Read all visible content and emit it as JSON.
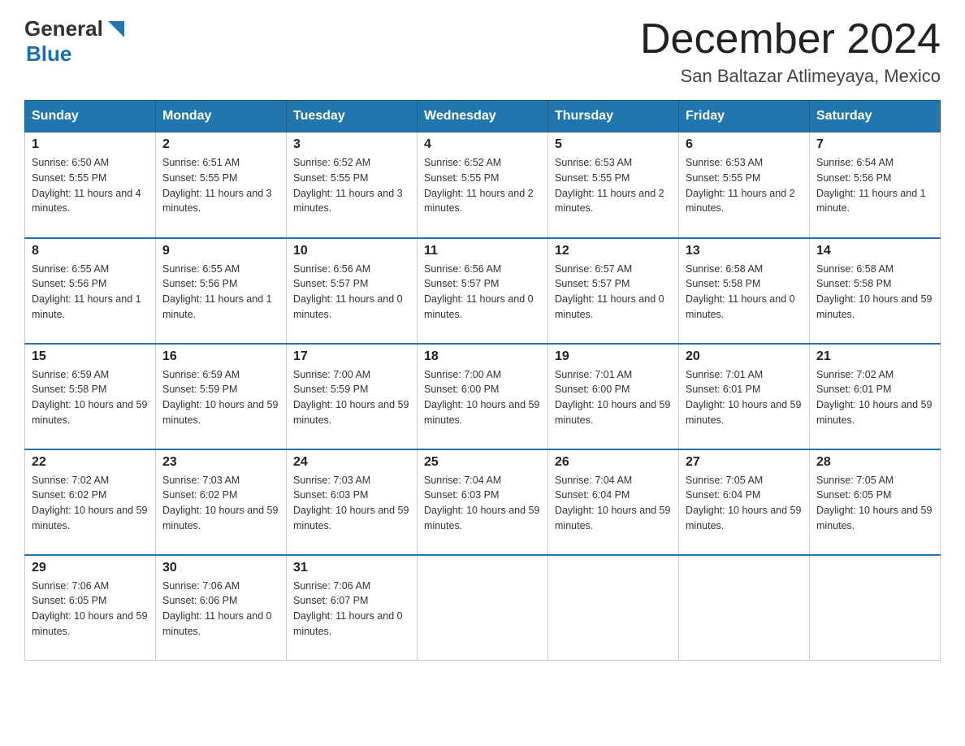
{
  "header": {
    "logo_general": "General",
    "logo_blue": "Blue",
    "title": "December 2024",
    "subtitle": "San Baltazar Atlimeyaya, Mexico"
  },
  "days_of_week": [
    "Sunday",
    "Monday",
    "Tuesday",
    "Wednesday",
    "Thursday",
    "Friday",
    "Saturday"
  ],
  "weeks": [
    [
      {
        "day": "1",
        "sunrise": "6:50 AM",
        "sunset": "5:55 PM",
        "daylight": "11 hours and 4 minutes."
      },
      {
        "day": "2",
        "sunrise": "6:51 AM",
        "sunset": "5:55 PM",
        "daylight": "11 hours and 3 minutes."
      },
      {
        "day": "3",
        "sunrise": "6:52 AM",
        "sunset": "5:55 PM",
        "daylight": "11 hours and 3 minutes."
      },
      {
        "day": "4",
        "sunrise": "6:52 AM",
        "sunset": "5:55 PM",
        "daylight": "11 hours and 2 minutes."
      },
      {
        "day": "5",
        "sunrise": "6:53 AM",
        "sunset": "5:55 PM",
        "daylight": "11 hours and 2 minutes."
      },
      {
        "day": "6",
        "sunrise": "6:53 AM",
        "sunset": "5:55 PM",
        "daylight": "11 hours and 2 minutes."
      },
      {
        "day": "7",
        "sunrise": "6:54 AM",
        "sunset": "5:56 PM",
        "daylight": "11 hours and 1 minute."
      }
    ],
    [
      {
        "day": "8",
        "sunrise": "6:55 AM",
        "sunset": "5:56 PM",
        "daylight": "11 hours and 1 minute."
      },
      {
        "day": "9",
        "sunrise": "6:55 AM",
        "sunset": "5:56 PM",
        "daylight": "11 hours and 1 minute."
      },
      {
        "day": "10",
        "sunrise": "6:56 AM",
        "sunset": "5:57 PM",
        "daylight": "11 hours and 0 minutes."
      },
      {
        "day": "11",
        "sunrise": "6:56 AM",
        "sunset": "5:57 PM",
        "daylight": "11 hours and 0 minutes."
      },
      {
        "day": "12",
        "sunrise": "6:57 AM",
        "sunset": "5:57 PM",
        "daylight": "11 hours and 0 minutes."
      },
      {
        "day": "13",
        "sunrise": "6:58 AM",
        "sunset": "5:58 PM",
        "daylight": "11 hours and 0 minutes."
      },
      {
        "day": "14",
        "sunrise": "6:58 AM",
        "sunset": "5:58 PM",
        "daylight": "10 hours and 59 minutes."
      }
    ],
    [
      {
        "day": "15",
        "sunrise": "6:59 AM",
        "sunset": "5:58 PM",
        "daylight": "10 hours and 59 minutes."
      },
      {
        "day": "16",
        "sunrise": "6:59 AM",
        "sunset": "5:59 PM",
        "daylight": "10 hours and 59 minutes."
      },
      {
        "day": "17",
        "sunrise": "7:00 AM",
        "sunset": "5:59 PM",
        "daylight": "10 hours and 59 minutes."
      },
      {
        "day": "18",
        "sunrise": "7:00 AM",
        "sunset": "6:00 PM",
        "daylight": "10 hours and 59 minutes."
      },
      {
        "day": "19",
        "sunrise": "7:01 AM",
        "sunset": "6:00 PM",
        "daylight": "10 hours and 59 minutes."
      },
      {
        "day": "20",
        "sunrise": "7:01 AM",
        "sunset": "6:01 PM",
        "daylight": "10 hours and 59 minutes."
      },
      {
        "day": "21",
        "sunrise": "7:02 AM",
        "sunset": "6:01 PM",
        "daylight": "10 hours and 59 minutes."
      }
    ],
    [
      {
        "day": "22",
        "sunrise": "7:02 AM",
        "sunset": "6:02 PM",
        "daylight": "10 hours and 59 minutes."
      },
      {
        "day": "23",
        "sunrise": "7:03 AM",
        "sunset": "6:02 PM",
        "daylight": "10 hours and 59 minutes."
      },
      {
        "day": "24",
        "sunrise": "7:03 AM",
        "sunset": "6:03 PM",
        "daylight": "10 hours and 59 minutes."
      },
      {
        "day": "25",
        "sunrise": "7:04 AM",
        "sunset": "6:03 PM",
        "daylight": "10 hours and 59 minutes."
      },
      {
        "day": "26",
        "sunrise": "7:04 AM",
        "sunset": "6:04 PM",
        "daylight": "10 hours and 59 minutes."
      },
      {
        "day": "27",
        "sunrise": "7:05 AM",
        "sunset": "6:04 PM",
        "daylight": "10 hours and 59 minutes."
      },
      {
        "day": "28",
        "sunrise": "7:05 AM",
        "sunset": "6:05 PM",
        "daylight": "10 hours and 59 minutes."
      }
    ],
    [
      {
        "day": "29",
        "sunrise": "7:06 AM",
        "sunset": "6:05 PM",
        "daylight": "10 hours and 59 minutes."
      },
      {
        "day": "30",
        "sunrise": "7:06 AM",
        "sunset": "6:06 PM",
        "daylight": "11 hours and 0 minutes."
      },
      {
        "day": "31",
        "sunrise": "7:06 AM",
        "sunset": "6:07 PM",
        "daylight": "11 hours and 0 minutes."
      },
      null,
      null,
      null,
      null
    ]
  ]
}
